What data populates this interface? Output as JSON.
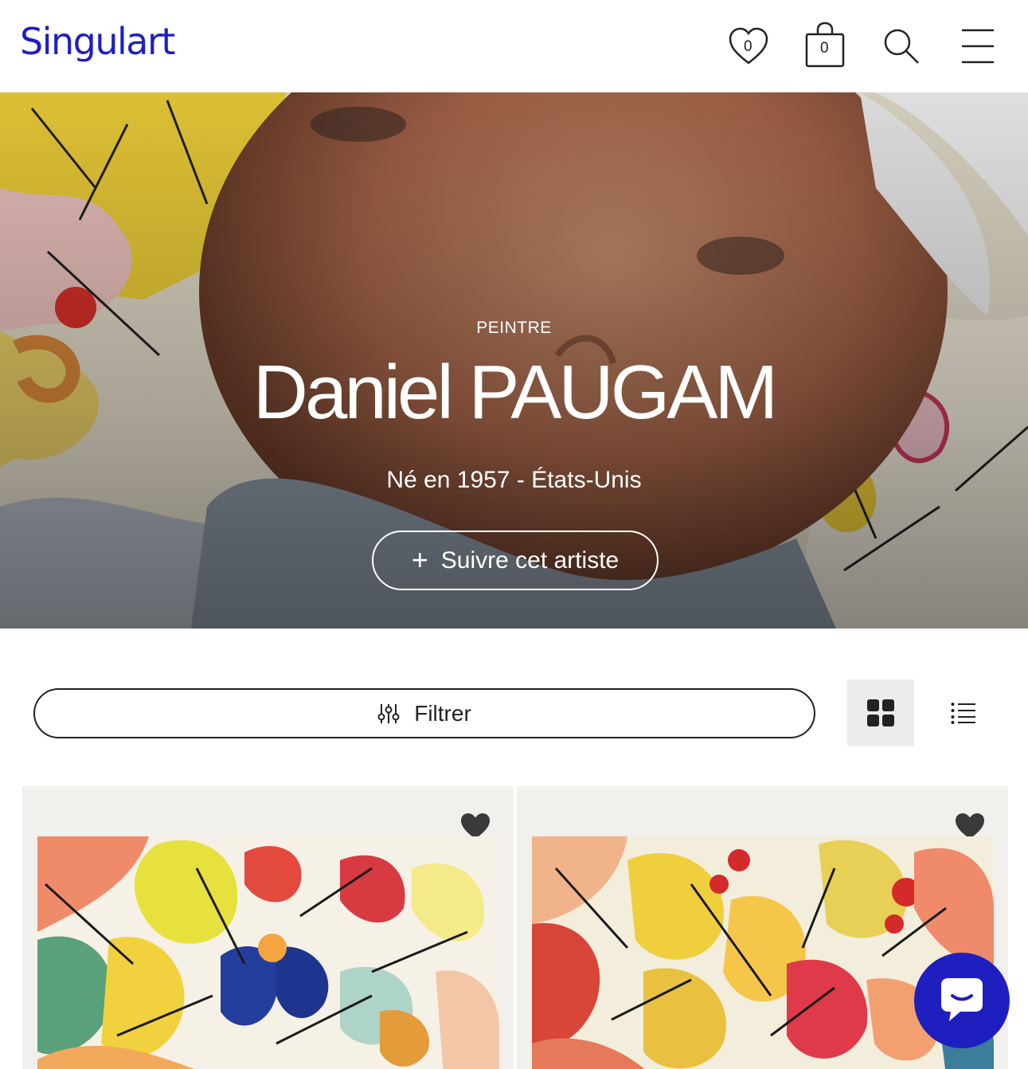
{
  "header": {
    "logo": "Singulart",
    "wishlist_count": "0",
    "cart_count": "0",
    "icons": [
      "heart-icon",
      "shopping-bag-icon",
      "search-icon",
      "hamburger-menu-icon"
    ]
  },
  "hero": {
    "kicker": "PEINTRE",
    "artist_name": "Daniel PAUGAM",
    "meta": "Né en 1957 - États-Unis",
    "follow_label": "Suivre cet artiste"
  },
  "toolbar": {
    "filter_label": "Filtrer",
    "view_mode_selected": "grid"
  },
  "colors": {
    "brand": "#1f1fbf",
    "card_bg": "#f2f0ec",
    "view_selected_bg": "#ececec"
  }
}
